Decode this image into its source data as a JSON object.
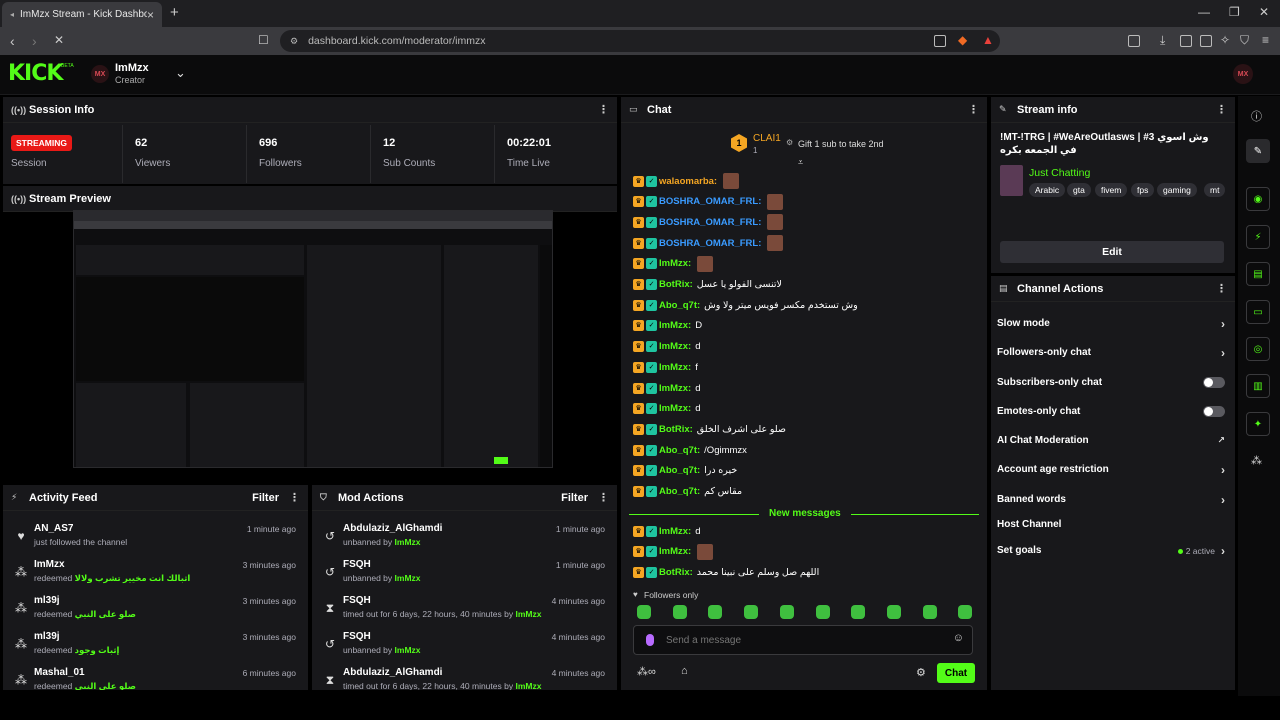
{
  "browser": {
    "tab_title": "ImMzx Stream - Kick Dashboard",
    "url": "dashboard.kick.com/moderator/immzx"
  },
  "header": {
    "logo": "KICK",
    "logo_badge": "BETA",
    "avatar_initials": "MX",
    "user_name": "ImMzx",
    "user_role": "Creator"
  },
  "session": {
    "title": "Session Info",
    "status_badge": "STREAMING",
    "status_label": "Session",
    "stats": [
      {
        "value": "62",
        "label": "Viewers"
      },
      {
        "value": "696",
        "label": "Followers"
      },
      {
        "value": "12",
        "label": "Sub Counts"
      },
      {
        "value": "00:22:01",
        "label": "Time Live"
      }
    ]
  },
  "preview": {
    "title": "Stream Preview"
  },
  "activity": {
    "title": "Activity Feed",
    "filter": "Filter",
    "items": [
      {
        "name": "AN_AS7",
        "action": "just followed the channel",
        "detail": "",
        "time": "1 minute ago"
      },
      {
        "name": "ImMzx",
        "action": "redeemed",
        "detail": "اثبالك انت مخيير تشرب ولالا",
        "time": "3 minutes ago"
      },
      {
        "name": "ml39j",
        "action": "redeemed",
        "detail": "صلو على النبي",
        "time": "3 minutes ago"
      },
      {
        "name": "ml39j",
        "action": "redeemed",
        "detail": "إثبات وجود",
        "time": "3 minutes ago"
      },
      {
        "name": "Mashal_01",
        "action": "redeemed",
        "detail": "صلو على النبي",
        "time": "6 minutes ago"
      }
    ]
  },
  "mod_actions": {
    "title": "Mod Actions",
    "filter": "Filter",
    "items": [
      {
        "name": "Abdulaziz_AlGhamdi",
        "action": "unbanned by",
        "by": "ImMzx",
        "time": "1 minute ago"
      },
      {
        "name": "FSQH",
        "action": "unbanned by",
        "by": "ImMzx",
        "time": "1 minute ago"
      },
      {
        "name": "FSQH",
        "action": "timed out for 6 days, 22 hours, 40 minutes by",
        "by": "ImMzx",
        "time": "4 minutes ago"
      },
      {
        "name": "FSQH",
        "action": "unbanned by",
        "by": "ImMzx",
        "time": "4 minutes ago"
      },
      {
        "name": "Abdulaziz_AlGhamdi",
        "action": "timed out for 6 days, 22 hours, 40 minutes by",
        "by": "ImMzx",
        "time": "4 minutes ago"
      }
    ]
  },
  "chat": {
    "title": "Chat",
    "pinned_user": "CLAI1",
    "pinned_count": "1",
    "gift_text": "Gift 1 sub to take 2nd",
    "messages": [
      {
        "user": "walaomarba:",
        "color": "#f5a623",
        "text": ""
      },
      {
        "user": "BOSHRA_OMAR_FRL:",
        "color": "#3a9bff",
        "text": ""
      },
      {
        "user": "BOSHRA_OMAR_FRL:",
        "color": "#3a9bff",
        "text": ""
      },
      {
        "user": "BOSHRA_OMAR_FRL:",
        "color": "#3a9bff",
        "text": ""
      },
      {
        "user": "ImMzx:",
        "color": "#53fc18",
        "text": ""
      },
      {
        "user": "BotRix:",
        "color": "#53fc18",
        "text": "لاتنسى الفولو يا عسل"
      },
      {
        "user": "Abo_q7t:",
        "color": "#53fc18",
        "text": "وش تستخدم مكسر فويس ميتر ولا وش"
      },
      {
        "user": "ImMzx:",
        "color": "#53fc18",
        "text": "D"
      },
      {
        "user": "ImMzx:",
        "color": "#53fc18",
        "text": "d"
      },
      {
        "user": "ImMzx:",
        "color": "#53fc18",
        "text": "f"
      },
      {
        "user": "ImMzx:",
        "color": "#53fc18",
        "text": "d"
      },
      {
        "user": "ImMzx:",
        "color": "#53fc18",
        "text": "d"
      },
      {
        "user": "BotRix:",
        "color": "#53fc18",
        "text": "صلو على اشرف الخلق"
      },
      {
        "user": "Abo_q7t:",
        "color": "#53fc18",
        "text": "/Ogimmzx"
      },
      {
        "user": "Abo_q7t:",
        "color": "#53fc18",
        "text": "خيره درا"
      },
      {
        "user": "Abo_q7t:",
        "color": "#53fc18",
        "text": "مقاس كم"
      }
    ],
    "new_messages_label": "New messages",
    "new_messages": [
      {
        "user": "ImMzx:",
        "color": "#53fc18",
        "text": "d"
      },
      {
        "user": "ImMzx:",
        "color": "#53fc18",
        "text": ""
      },
      {
        "user": "BotRix:",
        "color": "#53fc18",
        "text": "اللهم صل وسلم على نبينا محمد"
      }
    ],
    "followers_only": "Followers only",
    "input_placeholder": "Send a message",
    "send_label": "Chat"
  },
  "stream_info": {
    "title": "Stream info",
    "stream_title": "!MT-!TRG | #WeAreOutlasws | #3 وش اسوي في الجمعه بكره",
    "category": "Just Chatting",
    "tags": [
      "Arabic",
      "gta",
      "fivem",
      "fps",
      "gaming",
      "mt"
    ],
    "edit_label": "Edit"
  },
  "channel_actions": {
    "title": "Channel Actions",
    "items": [
      {
        "label": "Slow mode",
        "control": "chevron"
      },
      {
        "label": "Followers-only chat",
        "control": "chevron"
      },
      {
        "label": "Subscribers-only chat",
        "control": "toggle"
      },
      {
        "label": "Emotes-only chat",
        "control": "toggle"
      },
      {
        "label": "AI Chat Moderation",
        "control": "external"
      },
      {
        "label": "Account age restriction",
        "control": "chevron"
      },
      {
        "label": "Banned words",
        "control": "chevron"
      },
      {
        "label": "Host Channel",
        "control": "none"
      },
      {
        "label": "Set goals",
        "control": "chevron",
        "note": "2 active"
      }
    ]
  },
  "colors": {
    "accent": "#53fc18",
    "live": "#e91916",
    "panel": "#18181b"
  }
}
